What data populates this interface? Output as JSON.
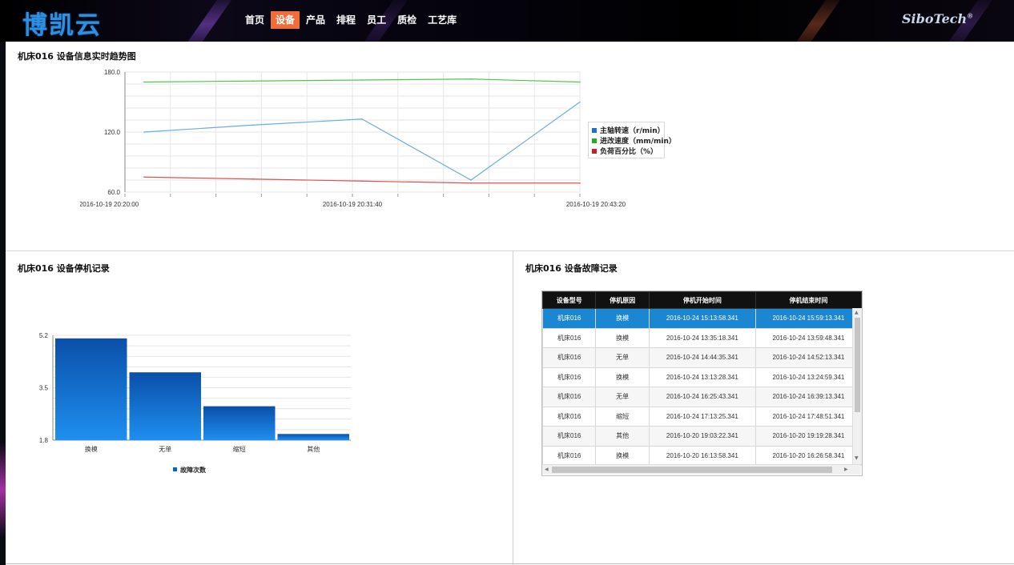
{
  "header": {
    "logo": "博凯云",
    "nav": [
      {
        "label": "首页",
        "active": false
      },
      {
        "label": "设备",
        "active": true
      },
      {
        "label": "产品",
        "active": false
      },
      {
        "label": "排程",
        "active": false
      },
      {
        "label": "员工",
        "active": false
      },
      {
        "label": "质检",
        "active": false
      },
      {
        "label": "工艺库",
        "active": false
      }
    ],
    "brand": "SiboTech",
    "brand_mark": "®",
    "active_color": "#f26b3a"
  },
  "trend_panel": {
    "title": "机床016 设备信息实时趋势图"
  },
  "downtime_panel": {
    "title": "机床016 设备停机记录"
  },
  "fault_panel": {
    "title": "机床016 设备故障记录",
    "columns": [
      "设备型号",
      "停机原因",
      "停机开始时间",
      "停机结束时间"
    ],
    "rows": [
      [
        "机床016",
        "换模",
        "2016-10-24 15:13:58.341",
        "2016-10-24 15:59:13.341"
      ],
      [
        "机床016",
        "换模",
        "2016-10-24 13:35:18.341",
        "2016-10-24 13:59:48.341"
      ],
      [
        "机床016",
        "无单",
        "2016-10-24 14:44:35.341",
        "2016-10-24 14:52:13.341"
      ],
      [
        "机床016",
        "换模",
        "2016-10-24 13:13:28.341",
        "2016-10-24 13:24:59.341"
      ],
      [
        "机床016",
        "无单",
        "2016-10-24 16:25:43.341",
        "2016-10-24 16:39:13.341"
      ],
      [
        "机床016",
        "缩短",
        "2016-10-24 17:13:25.341",
        "2016-10-24 17:48:51.341"
      ],
      [
        "机床016",
        "其他",
        "2016-10-20 19:03:22.341",
        "2016-10-20 19:19:28.341"
      ],
      [
        "机床016",
        "换模",
        "2016-10-20 16:13:58.341",
        "2016-10-20 16:26:58.341"
      ]
    ],
    "selected_row": 0,
    "selected_color": "#1b86d1"
  },
  "chart_data": [
    {
      "type": "line",
      "x": [
        "2016-10-19 20:20:00",
        "2016-10-19 20:25:20",
        "2016-10-19 20:31:20",
        "2016-10-19 20:37:20",
        "2016-10-19 20:43:20"
      ],
      "x_tick_labels": [
        "2016-10-19 20:20:00",
        "2016-10-19 20:31:40",
        "2016-10-19 20:43:20"
      ],
      "y_tick_labels": [
        "180.0",
        "120.0",
        "60.0"
      ],
      "ylim": [
        60,
        180
      ],
      "grid": true,
      "legend_position": "right",
      "series": [
        {
          "name": "主轴转速（r/min）",
          "color": "#6aaee0",
          "values": [
            120,
            127,
            133,
            72,
            150
          ]
        },
        {
          "name": "进改速度（mm/min）",
          "color": "#4cc84c",
          "values": [
            170,
            171,
            172,
            173,
            170
          ]
        },
        {
          "name": "负荷百分比（%）",
          "color": "#e05050",
          "values": [
            75,
            73,
            71,
            69,
            69
          ]
        }
      ],
      "legend_colors": [
        "#1f6fd0",
        "#22b022",
        "#cc2020"
      ]
    },
    {
      "type": "bar",
      "categories": [
        "换模",
        "无单",
        "缩短",
        "其他"
      ],
      "series": [
        {
          "name": "故障次数",
          "values": [
            5.1,
            4.0,
            2.9,
            2.0
          ]
        }
      ],
      "y_tick_labels": [
        "5.2",
        "3.5",
        "1.8"
      ],
      "ylim": [
        1.8,
        5.2
      ],
      "grid": true,
      "legend_position": "bottom",
      "bar_color": "#0b63c9"
    }
  ]
}
